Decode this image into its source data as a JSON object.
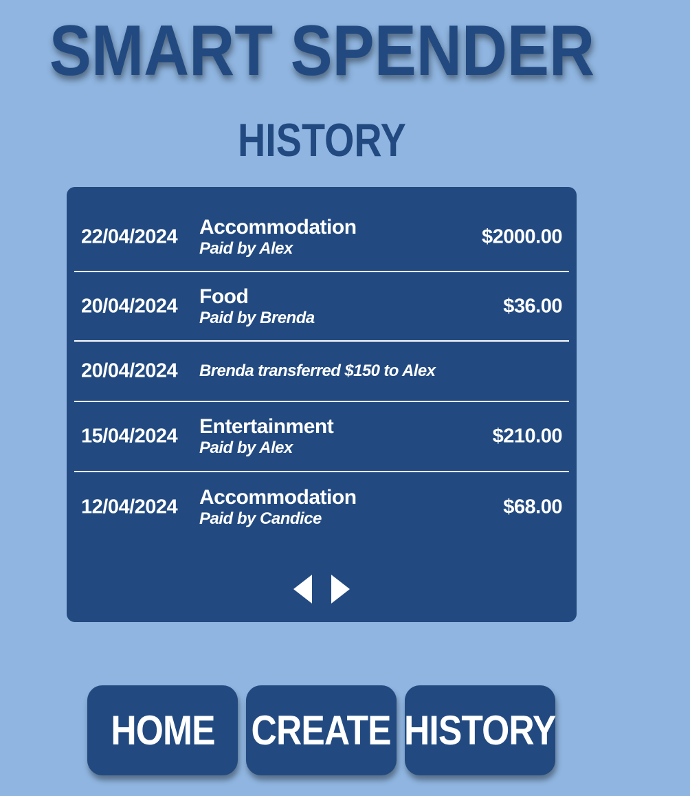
{
  "app": {
    "title": "SMART SPENDER"
  },
  "page": {
    "title": "HISTORY"
  },
  "history": [
    {
      "date": "22/04/2024",
      "category": "Accommodation",
      "payer": "Paid by Alex",
      "amount": "$2000.00"
    },
    {
      "date": "20/04/2024",
      "category": "Food",
      "payer": "Paid by Brenda",
      "amount": "$36.00"
    },
    {
      "date": "20/04/2024",
      "transfer": "Brenda transferred $150 to Alex"
    },
    {
      "date": "15/04/2024",
      "category": "Entertainment",
      "payer": "Paid by Alex",
      "amount": "$210.00"
    },
    {
      "date": "12/04/2024",
      "category": "Accommodation",
      "payer": "Paid by Candice",
      "amount": "$68.00"
    }
  ],
  "pager": {
    "prev_icon": "triangle-left-icon",
    "next_icon": "triangle-right-icon"
  },
  "nav": {
    "home": "HOME",
    "create": "CREATE",
    "history": "HISTORY"
  },
  "colors": {
    "background": "#8fb5e0",
    "primary": "#224a80",
    "text_light": "#ffffff"
  }
}
